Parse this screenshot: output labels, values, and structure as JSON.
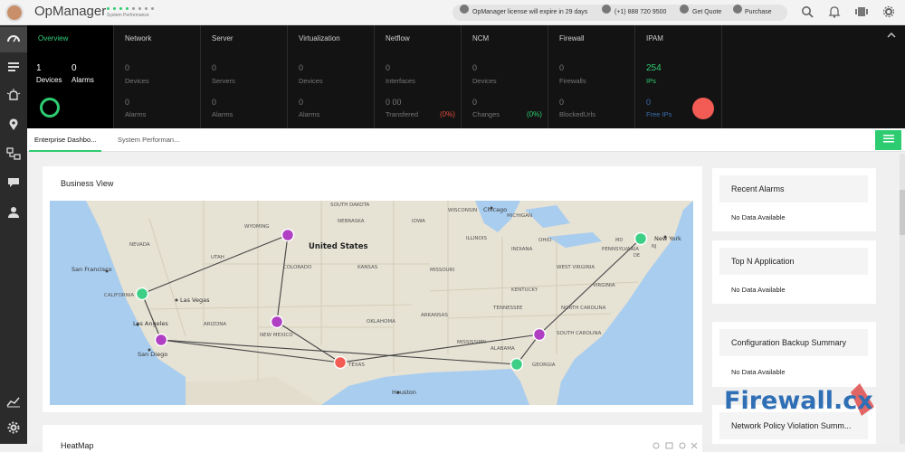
{
  "app": {
    "name": "OpManager",
    "subtitle": "System Performance"
  },
  "header": {
    "license_notice": "OpManager license will expire in 29 days",
    "phone": "(+1) 888 720 9500",
    "get_quote": "Get Quote",
    "purchase": "Purchase"
  },
  "stats": {
    "overview": {
      "label": "Overview",
      "devices_value": "1",
      "devices_label": "Devices",
      "alarms_value": "0",
      "alarms_label": "Alarms"
    },
    "network": {
      "label": "Network",
      "v1": "0",
      "l1": "Devices",
      "v2": "0",
      "l2": "Alarms"
    },
    "server": {
      "label": "Server",
      "v1": "0",
      "l1": "Servers",
      "v2": "0",
      "l2": "Alarms"
    },
    "virtualization": {
      "label": "Virtualization",
      "v1": "0",
      "l1": "Devices",
      "v2": "0",
      "l2": "Alarms"
    },
    "netflow": {
      "label": "Netflow",
      "v1": "0",
      "l1": "Interfaces",
      "v2": "0 00",
      "l2": "Transfered",
      "pct": "(0%)"
    },
    "ncm": {
      "label": "NCM",
      "v1": "0",
      "l1": "Devices",
      "v2": "0",
      "l2": "Changes",
      "pct": "(0%)"
    },
    "firewall": {
      "label": "Firewall",
      "v1": "0",
      "l1": "Firewalls",
      "v2": "0",
      "l2": "BlockedUrls"
    },
    "ipam": {
      "label": "IPAM",
      "v1": "254",
      "l1": "IPs",
      "v2": "0",
      "l2": "Free IPs"
    }
  },
  "tabs": [
    "Enterprise Dashbo...",
    "System Performan..."
  ],
  "business_view": {
    "title": "Business View",
    "map_labels": {
      "country": "United States",
      "states": [
        "NEVADA",
        "UTAH",
        "COLORADO",
        "KANSAS",
        "MISSOURI",
        "NEBRASKA",
        "IOWA",
        "ILLINOIS",
        "INDIANA",
        "OHIO",
        "ARIZONA",
        "NEW MEXICO",
        "OKLAHOMA",
        "TEXAS",
        "ARKANSAS",
        "MISSISSIPPI",
        "ALABAMA",
        "GEORGIA",
        "TENNESSEE",
        "KENTUCKY",
        "VIRGINIA",
        "NORTH CAROLINA",
        "SOUTH CAROLINA",
        "WEST VIRGINIA",
        "PENNSYLVANIA",
        "MICHIGAN",
        "WISCONSIN",
        "SOUTH DAKOTA",
        "WYOMING",
        "CALIFORNIA",
        "MD",
        "DE",
        "NJ"
      ],
      "cities": [
        "San Francisco",
        "Las Vegas",
        "Los Angeles",
        "San Diego",
        "Houston",
        "Chicago",
        "New York"
      ]
    }
  },
  "heat_map": {
    "title": "HeatMap"
  },
  "widgets": [
    {
      "title": "Recent Alarms",
      "body": "No Data Available"
    },
    {
      "title": "Top N Application",
      "body": "No Data Available"
    },
    {
      "title": "Configuration Backup Summary",
      "body": "No Data Available"
    },
    {
      "title": "Network Policy Violation Summ..."
    }
  ],
  "watermark": {
    "text": "Firewall.cx"
  },
  "colors": {
    "accent_green": "#2ecc71",
    "node_purple": "#b13fc4",
    "node_red": "#f25c54",
    "dark_panel": "#131313"
  }
}
